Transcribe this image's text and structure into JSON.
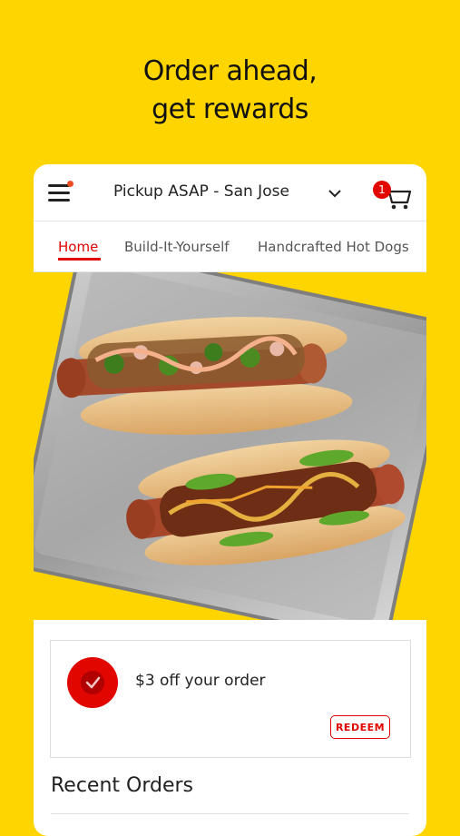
{
  "headline": {
    "line1": "Order ahead,",
    "line2": "get rewards"
  },
  "header": {
    "location": "Pickup ASAP - San Jose",
    "cart_count": "1"
  },
  "tabs": [
    {
      "label": "Home",
      "active": true
    },
    {
      "label": "Build-It-Yourself",
      "active": false
    },
    {
      "label": "Handcrafted Hot Dogs",
      "active": false
    }
  ],
  "reward": {
    "text": "$3 off your order",
    "button_label": "REDEEM"
  },
  "recent_orders": {
    "title": "Recent Orders"
  },
  "colors": {
    "background": "#FFD500",
    "accent_red": "#E10600",
    "notification_dot": "#E94F24"
  },
  "icons": [
    "hamburger-menu-icon",
    "chevron-down-icon",
    "cart-icon",
    "check-circle-icon"
  ]
}
